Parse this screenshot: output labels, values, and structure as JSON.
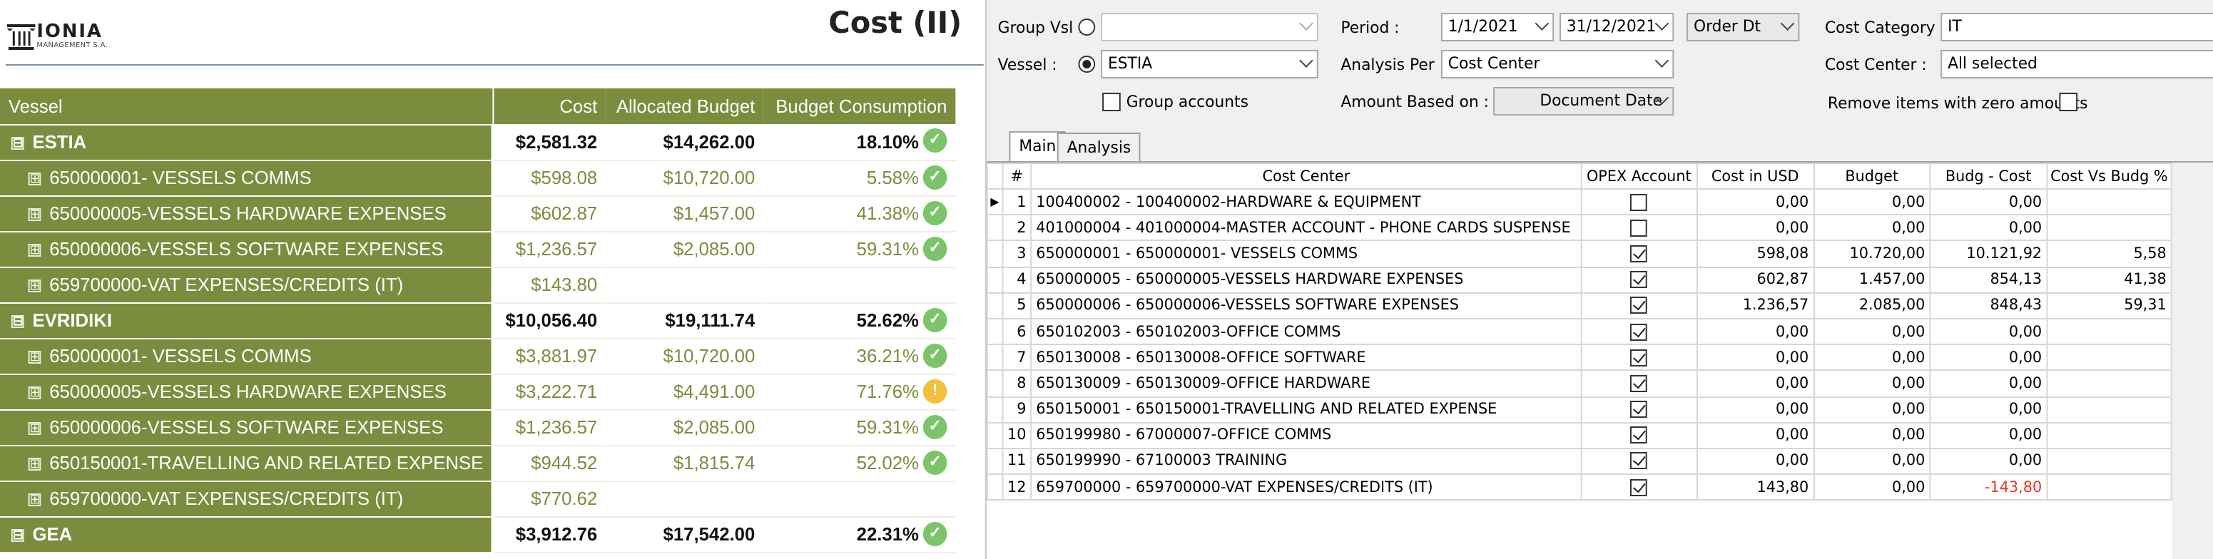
{
  "report": {
    "logo_name": "IONIA",
    "logo_sub": "MANAGEMENT S.A.",
    "title": "Cost (II)",
    "columns": [
      "Vessel",
      "Cost",
      "Allocated Budget",
      "Budget Consumption"
    ],
    "rows": [
      {
        "type": "group",
        "name": "ESTIA",
        "cost": "$2,581.32",
        "budget": "$14,262.00",
        "pct": "18.10%",
        "status": "ok"
      },
      {
        "type": "sub",
        "name": "650000001- VESSELS COMMS",
        "cost": "$598.08",
        "budget": "$10,720.00",
        "pct": "5.58%",
        "status": "ok"
      },
      {
        "type": "sub",
        "name": "650000005-VESSELS HARDWARE EXPENSES",
        "cost": "$602.87",
        "budget": "$1,457.00",
        "pct": "41.38%",
        "status": "ok"
      },
      {
        "type": "sub",
        "name": "650000006-VESSELS SOFTWARE EXPENSES",
        "cost": "$1,236.57",
        "budget": "$2,085.00",
        "pct": "59.31%",
        "status": "ok"
      },
      {
        "type": "sub",
        "name": "659700000-VAT EXPENSES/CREDITS (IT)",
        "cost": "$143.80",
        "budget": "",
        "pct": "",
        "status": ""
      },
      {
        "type": "group",
        "name": "EVRIDIKI",
        "cost": "$10,056.40",
        "budget": "$19,111.74",
        "pct": "52.62%",
        "status": "ok"
      },
      {
        "type": "sub",
        "name": "650000001- VESSELS COMMS",
        "cost": "$3,881.97",
        "budget": "$10,720.00",
        "pct": "36.21%",
        "status": "ok"
      },
      {
        "type": "sub",
        "name": "650000005-VESSELS HARDWARE EXPENSES",
        "cost": "$3,222.71",
        "budget": "$4,491.00",
        "pct": "71.76%",
        "status": "warn"
      },
      {
        "type": "sub",
        "name": "650000006-VESSELS SOFTWARE EXPENSES",
        "cost": "$1,236.57",
        "budget": "$2,085.00",
        "pct": "59.31%",
        "status": "ok"
      },
      {
        "type": "sub",
        "name": "650150001-TRAVELLING AND RELATED EXPENSE",
        "cost": "$944.52",
        "budget": "$1,815.74",
        "pct": "52.02%",
        "status": "ok"
      },
      {
        "type": "sub",
        "name": "659700000-VAT EXPENSES/CREDITS (IT)",
        "cost": "$770.62",
        "budget": "",
        "pct": "",
        "status": ""
      },
      {
        "type": "group",
        "name": "GEA",
        "cost": "$3,912.76",
        "budget": "$17,542.00",
        "pct": "22.31%",
        "status": "ok"
      }
    ],
    "expand_symbol": "⊞",
    "collapse_symbol": "⊟"
  },
  "filters": {
    "group_vsl_label": "Group Vsl :",
    "group_vsl_value": "",
    "vessel_label": "Vessel :",
    "vessel_value": "ESTIA",
    "group_accounts_label": "Group accounts",
    "period_label": "Period :",
    "period_from": "1/1/2021",
    "period_to": "31/12/2021",
    "order_dt": "Order Dt",
    "analysis_per_label": "Analysis Per :",
    "analysis_per_value": "Cost Center",
    "amount_based_label": "Amount Based on :",
    "amount_based_value": "Document Date",
    "cost_category_label": "Cost Category :",
    "cost_category_value": "IT",
    "cost_center_label": "Cost Center :",
    "cost_center_value": "All selected",
    "remove_zero_label": "Remove items with zero amounts"
  },
  "tabs": [
    "Main",
    "Analysis"
  ],
  "grid": {
    "columns": [
      "#",
      "Cost Center",
      "OPEX Account",
      "Cost in USD",
      "Budget",
      "Budg - Cost",
      "Cost Vs Budg %"
    ],
    "rows": [
      {
        "n": "1",
        "center": "100400002 - 100400002-HARDWARE & EQUIPMENT",
        "opex": false,
        "cost": "0,00",
        "budget": "0,00",
        "diff": "0,00",
        "pct": "",
        "current": true
      },
      {
        "n": "2",
        "center": "401000004 - 401000004-MASTER ACCOUNT - PHONE CARDS SUSPENSE",
        "opex": false,
        "cost": "0,00",
        "budget": "0,00",
        "diff": "0,00",
        "pct": ""
      },
      {
        "n": "3",
        "center": "650000001 - 650000001- VESSELS COMMS",
        "opex": true,
        "cost": "598,08",
        "budget": "10.720,00",
        "diff": "10.121,92",
        "pct": "5,58"
      },
      {
        "n": "4",
        "center": "650000005 - 650000005-VESSELS HARDWARE EXPENSES",
        "opex": true,
        "cost": "602,87",
        "budget": "1.457,00",
        "diff": "854,13",
        "pct": "41,38"
      },
      {
        "n": "5",
        "center": "650000006 - 650000006-VESSELS SOFTWARE EXPENSES",
        "opex": true,
        "cost": "1.236,57",
        "budget": "2.085,00",
        "diff": "848,43",
        "pct": "59,31"
      },
      {
        "n": "6",
        "center": "650102003 - 650102003-OFFICE COMMS",
        "opex": true,
        "cost": "0,00",
        "budget": "0,00",
        "diff": "0,00",
        "pct": ""
      },
      {
        "n": "7",
        "center": "650130008 - 650130008-OFFICE SOFTWARE",
        "opex": true,
        "cost": "0,00",
        "budget": "0,00",
        "diff": "0,00",
        "pct": ""
      },
      {
        "n": "8",
        "center": "650130009 - 650130009-OFFICE HARDWARE",
        "opex": true,
        "cost": "0,00",
        "budget": "0,00",
        "diff": "0,00",
        "pct": ""
      },
      {
        "n": "9",
        "center": "650150001 - 650150001-TRAVELLING AND RELATED EXPENSE",
        "opex": true,
        "cost": "0,00",
        "budget": "0,00",
        "diff": "0,00",
        "pct": ""
      },
      {
        "n": "10",
        "center": "650199980 - 67000007-OFFICE COMMS",
        "opex": true,
        "cost": "0,00",
        "budget": "0,00",
        "diff": "0,00",
        "pct": ""
      },
      {
        "n": "11",
        "center": "650199990 - 67100003 TRAINING",
        "opex": true,
        "cost": "0,00",
        "budget": "0,00",
        "diff": "0,00",
        "pct": ""
      },
      {
        "n": "12",
        "center": "659700000 - 659700000-VAT EXPENSES/CREDITS (IT)",
        "opex": true,
        "cost": "143,80",
        "budget": "0,00",
        "diff": "-143,80",
        "pct": "",
        "negative": true
      }
    ]
  },
  "colors": {
    "report_green": "#7b8c3e",
    "status_ok": "#7cc46a",
    "status_warn": "#f3bf3d",
    "negative": "#e0392b"
  }
}
